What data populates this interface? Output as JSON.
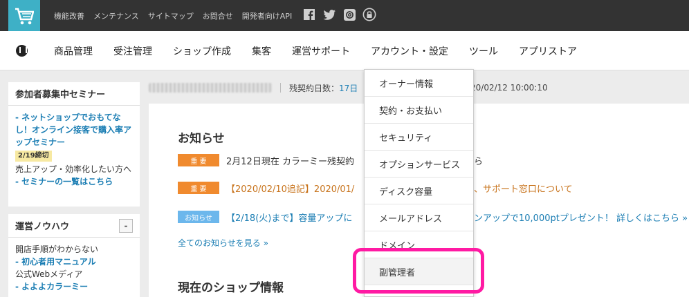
{
  "topbar": {
    "links": [
      "機能改善",
      "メンテナンス",
      "サイトマップ",
      "お問合せ",
      "開発者向けAPI"
    ],
    "social_icons": [
      "facebook-icon",
      "twitter-icon",
      "mail-icon",
      "lock-icon"
    ]
  },
  "nav": {
    "items": [
      "商品管理",
      "受注管理",
      "ショップ作成",
      "集客",
      "運営サポート",
      "アカウント・設定",
      "ツール",
      "アプリストア"
    ]
  },
  "sidebar": {
    "seminar": {
      "title": "参加者募集中セミナー",
      "link1": "- ネットショップでおもてなし！オンライン接客で購入率アップセミナー",
      "deadline": "2/19締切",
      "text1": "売上アップ・効率化したい方へ",
      "link2": "- セミナーの一覧はこちら"
    },
    "knowhow": {
      "title": "運営ノウハウ",
      "collapse": "-",
      "text1": "開店手順がわからない",
      "link1": "- 初心者用マニュアル",
      "text2": "公式Webメディア",
      "link2": "- よよよカラーミー"
    }
  },
  "infobar": {
    "remaining_label": "残契約日数：",
    "remaining_value": "17日",
    "date": "20/02/12 10:00:10"
  },
  "content": {
    "news_title": "お知らせ",
    "news": [
      {
        "tag": "重 要",
        "text": "2月12日現在 カラーミー残契約"
      },
      {
        "tag": "重 要",
        "text": "【2020/02/10追記】2020/01/"
      },
      {
        "tag": "お知らせ",
        "text": "【2/18(火)まで】容量アップに"
      }
    ],
    "news_tail": [
      "ら",
      "、サポート窓口について",
      "ンアップで10,000ptプレゼント！ 詳しくはこちら »"
    ],
    "all_news": "全てのお知らせを見る »",
    "shop_title": "現在のショップ情報"
  },
  "dropdown": {
    "items": [
      "オーナー情報",
      "契約・お支払い",
      "セキュリティ",
      "オプションサービス",
      "ディスク容量",
      "メールアドレス",
      "ドメイン",
      "副管理者"
    ]
  },
  "colors": {
    "topbar": "#333333",
    "logo": "#3eb0c6",
    "important": "#f08a2e",
    "info": "#6cb7ec",
    "link": "#1a7db3",
    "highlight": "#ff1aa3"
  }
}
